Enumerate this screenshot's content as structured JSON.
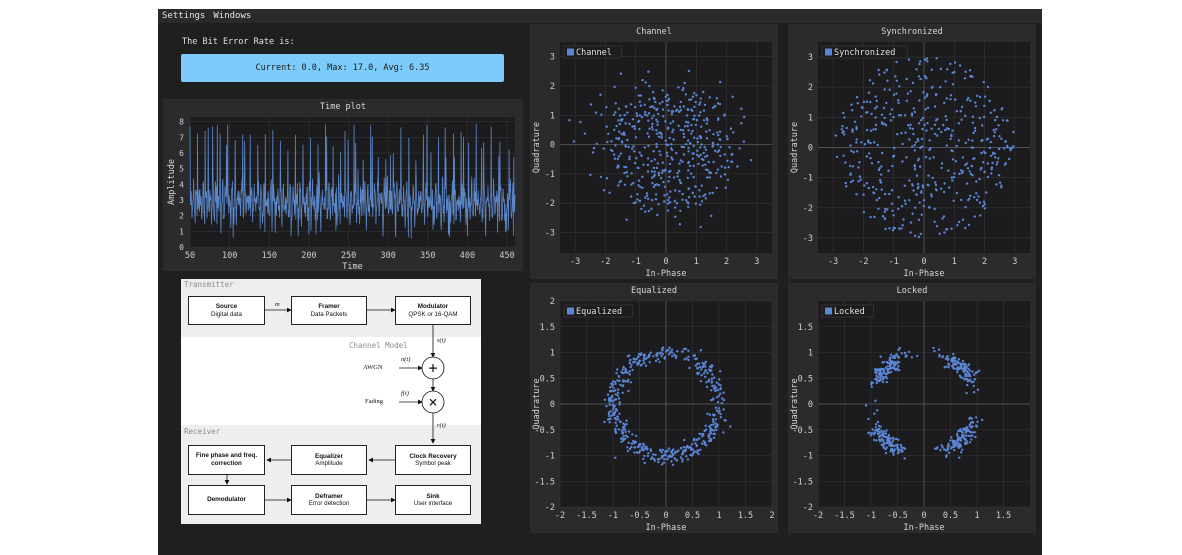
{
  "menu": [
    "Settings",
    "Windows"
  ],
  "ber": {
    "label": "The Bit Error Rate is:",
    "value_text": "Current: 0.0, Max: 17.0, Avg: 6.35",
    "color": "#7ccbfb"
  },
  "time_plot": {
    "title": "Time plot",
    "xlabel": "Time",
    "ylabel": "Amplitude",
    "x_ticks": [
      "50",
      "100",
      "150",
      "200",
      "250",
      "300",
      "350",
      "400",
      "450"
    ],
    "y_ticks": [
      "0",
      "1",
      "2",
      "3",
      "4",
      "5",
      "6",
      "7",
      "8"
    ],
    "xlim": [
      50,
      460
    ],
    "ylim": [
      0,
      8.3
    ],
    "line_color": "#5b86c7"
  },
  "scatter_plots": [
    {
      "id": "channel",
      "title": "Channel",
      "legend": "Channel",
      "xlabel": "In-Phase",
      "ylabel": "Quadrature",
      "x_ticks": [
        "-3",
        "-2",
        "-1",
        "0",
        "1",
        "2",
        "3"
      ],
      "y_ticks": [
        "-3",
        "-2",
        "-1",
        "0",
        "1",
        "2",
        "3"
      ],
      "xlim": [
        -3.5,
        3.5
      ],
      "ylim": [
        -3.7,
        3.5
      ],
      "shape": "ring",
      "radius": 1.55,
      "spread": 0.6
    },
    {
      "id": "synchronized",
      "title": "Synchronized",
      "legend": "Synchronized",
      "xlabel": "In-Phase",
      "ylabel": "Quadrature",
      "x_ticks": [
        "-3",
        "-2",
        "-1",
        "0",
        "1",
        "2",
        "3"
      ],
      "y_ticks": [
        "-3",
        "-2",
        "-1",
        "0",
        "1",
        "2",
        "3"
      ],
      "xlim": [
        -3.5,
        3.5
      ],
      "ylim": [
        -3.5,
        3.5
      ],
      "shape": "disk",
      "radius": 3.0,
      "spread": 0
    },
    {
      "id": "equalized",
      "title": "Equalized",
      "legend": "Equalized",
      "xlabel": "In-Phase",
      "ylabel": "Quadrature",
      "x_ticks": [
        "-2",
        "-1.5",
        "-1",
        "-0.5",
        "0",
        "0.5",
        "1",
        "1.5",
        "2"
      ],
      "y_ticks": [
        "-2",
        "-1.5",
        "-1",
        "-0.5",
        "0",
        "0.5",
        "1",
        "1.5",
        "2"
      ],
      "xlim": [
        -2,
        2
      ],
      "ylim": [
        -2,
        2
      ],
      "shape": "ring",
      "radius": 1.0,
      "spread": 0.08
    },
    {
      "id": "locked",
      "title": "Locked",
      "legend": "Locked",
      "xlabel": "In-Phase",
      "ylabel": "Quadrature",
      "x_ticks": [
        "-2",
        "-1.5",
        "-1",
        "-0.5",
        "0",
        "0.5",
        "1",
        "1.5"
      ],
      "y_ticks": [
        "-2",
        "-1.5",
        "-1",
        "-0.5",
        "0",
        "0.5",
        "1",
        "1.5"
      ],
      "xlim": [
        -2,
        2
      ],
      "ylim": [
        -2,
        2
      ],
      "shape": "qpsk",
      "radius": 1.0,
      "spread": 0.08
    }
  ],
  "point_color": "#5b86d6",
  "diagram": {
    "transmitter_label": "Transmitter",
    "channel_label": "Channel Model",
    "receiver_label": "Receiver",
    "blocks": {
      "source": {
        "title": "Source",
        "sub": "Digital data"
      },
      "framer": {
        "title": "Framer",
        "sub": "Data Packets"
      },
      "modulator": {
        "title": "Modulator",
        "sub": "QPSK or 16-QAM"
      },
      "clock": {
        "title": "Clock Recovery",
        "sub": "Symbol peak"
      },
      "equalizer": {
        "title": "Equalizer",
        "sub": "Amplitude"
      },
      "fine": {
        "title": "Fine phase and freq. correction",
        "sub": ""
      },
      "demod": {
        "title": "Demodulator",
        "sub": ""
      },
      "deframer": {
        "title": "Deframer",
        "sub": "Error detection"
      },
      "sink": {
        "title": "Sink",
        "sub": "User interface"
      }
    },
    "labels": {
      "m": "m",
      "st": "s(t)",
      "nt": "n(t)",
      "ft": "f(t)",
      "rt": "r(t)",
      "awgn": "AWGN",
      "fading": "Fading",
      "plus": "+",
      "times": "×"
    }
  }
}
